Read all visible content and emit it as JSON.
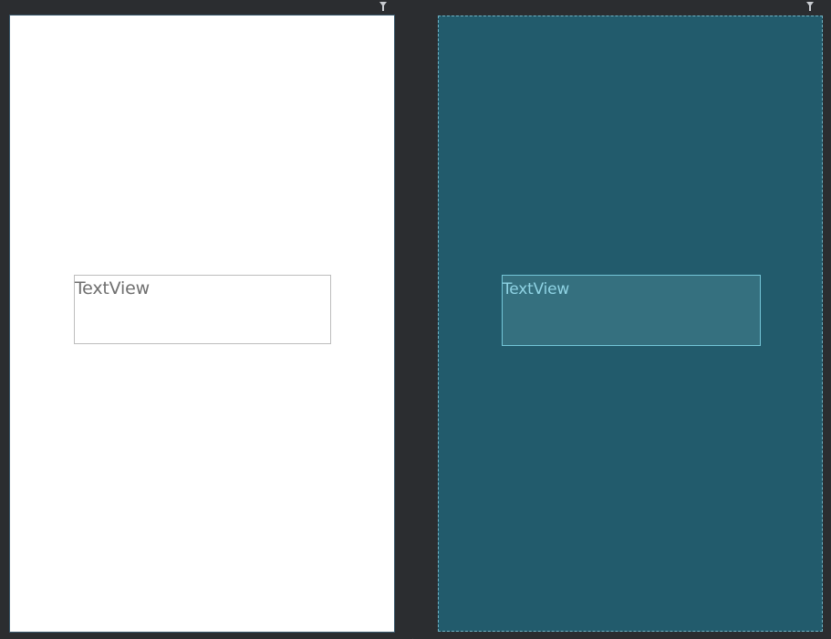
{
  "design_view": {
    "textview_label": "TextView",
    "background_color": "#ffffff"
  },
  "blueprint_view": {
    "textview_label": "TextView",
    "background_color": "#225b6c"
  },
  "icons": {
    "design_pin": "pin-icon",
    "blueprint_pin": "pin-icon",
    "resize": "resize-handle-icon"
  }
}
